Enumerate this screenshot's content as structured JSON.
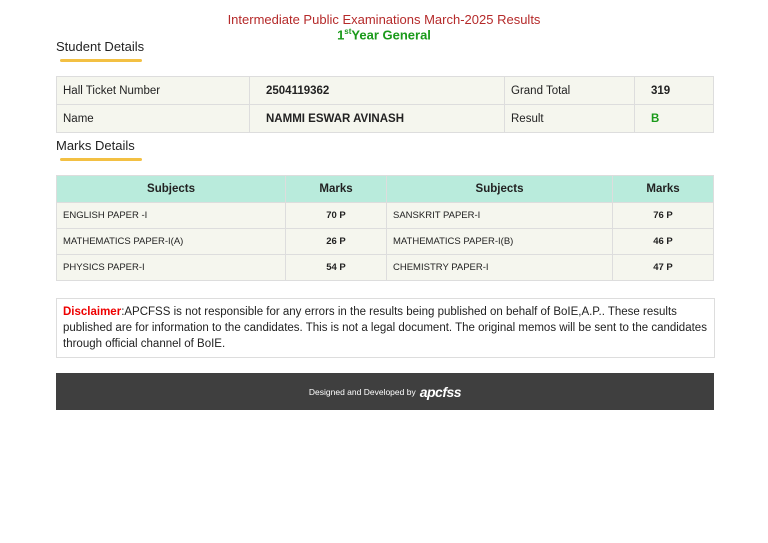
{
  "header": {
    "title": "Intermediate Public Examinations March-2025 Results",
    "year_num": "1",
    "year_sup": "st",
    "year_text": "Year General"
  },
  "student": {
    "heading": "Student Details",
    "hall_ticket_label": "Hall Ticket Number",
    "hall_ticket": "2504119362",
    "grand_total_label": "Grand Total",
    "grand_total": "319",
    "name_label": "Name",
    "name": "NAMMI ESWAR AVINASH",
    "result_label": "Result",
    "result": "B"
  },
  "marks": {
    "heading": "Marks Details",
    "headers": [
      "Subjects",
      "Marks",
      "Subjects",
      "Marks"
    ],
    "rows": [
      [
        "ENGLISH PAPER -I",
        "70 P",
        "SANSKRIT PAPER-I",
        "76 P"
      ],
      [
        "MATHEMATICS PAPER-I(A)",
        "26 P",
        "MATHEMATICS PAPER-I(B)",
        "46 P"
      ],
      [
        "PHYSICS PAPER-I",
        "54 P",
        "CHEMISTRY PAPER-I",
        "47 P"
      ]
    ]
  },
  "disclaimer": {
    "label": "Disclaimer",
    "text": ":APCFSS is not responsible for any errors in the results being published on behalf of BoIE,A.P.. These results published are for information to the candidates. This is not a legal document. The original memos will be sent to the candidates through official channel of BoIE."
  },
  "footer": {
    "text": "Designed and Developed by",
    "logo": "apcfss"
  }
}
